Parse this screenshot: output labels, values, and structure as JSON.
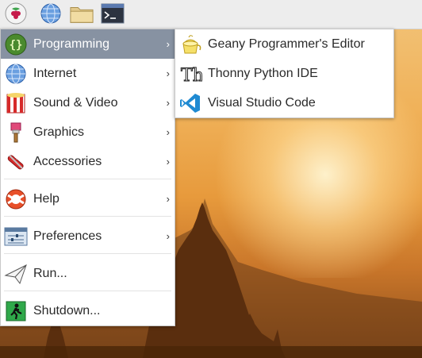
{
  "taskbar": {
    "buttons": [
      {
        "icon": "raspberry-icon"
      },
      {
        "icon": "globe-icon"
      },
      {
        "icon": "folder-icon"
      },
      {
        "icon": "terminal-icon"
      }
    ]
  },
  "main_menu": {
    "items": [
      {
        "label": "Programming",
        "icon": "programming-icon",
        "has_submenu": true,
        "active": true
      },
      {
        "label": "Internet",
        "icon": "internet-icon",
        "has_submenu": true
      },
      {
        "label": "Sound & Video",
        "icon": "sound-video-icon",
        "has_submenu": true
      },
      {
        "label": "Graphics",
        "icon": "graphics-icon",
        "has_submenu": true
      },
      {
        "label": "Accessories",
        "icon": "accessories-icon",
        "has_submenu": true
      },
      {
        "label": "Help",
        "icon": "help-icon",
        "has_submenu": true
      },
      {
        "label": "Preferences",
        "icon": "preferences-icon",
        "has_submenu": true
      },
      {
        "label": "Run...",
        "icon": "run-icon",
        "has_submenu": false
      },
      {
        "label": "Shutdown...",
        "icon": "shutdown-icon",
        "has_submenu": false
      }
    ],
    "submenu_arrow": "›"
  },
  "sub_menu": {
    "items": [
      {
        "label": "Geany Programmer's Editor",
        "icon": "geany-icon"
      },
      {
        "label": "Thonny Python IDE",
        "icon": "thonny-icon"
      },
      {
        "label": "Visual Studio Code",
        "icon": "vscode-icon"
      }
    ]
  },
  "colors": {
    "active_highlight": "#8792a2",
    "taskbar_bg": "#ededed",
    "menu_bg": "#ffffff"
  }
}
